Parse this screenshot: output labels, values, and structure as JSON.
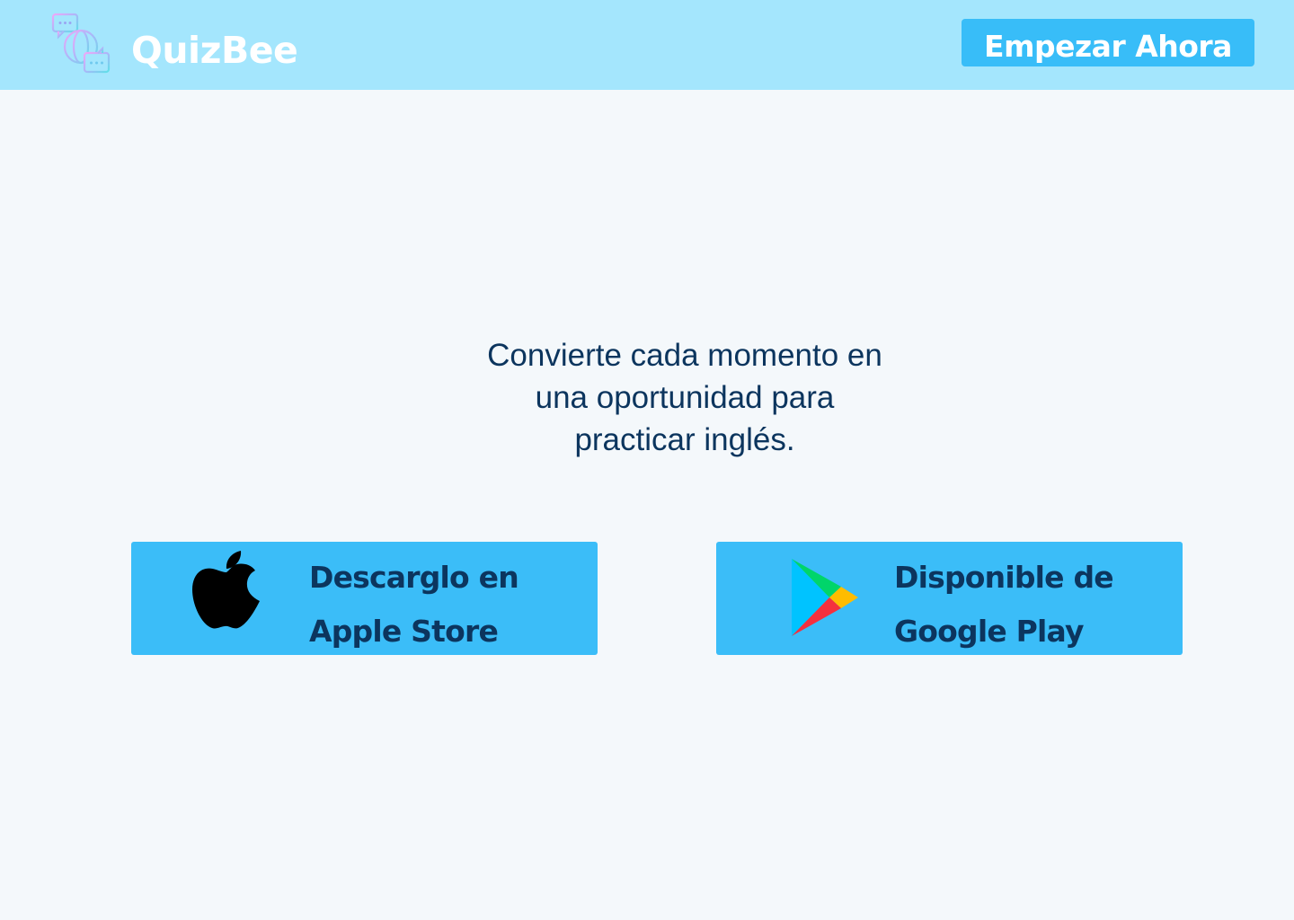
{
  "header": {
    "brand": "QuizBee",
    "logo_icon": "globe-chat-icon",
    "cta_label": "Empezar Ahora"
  },
  "hero": {
    "tagline_lines": [
      "Convierte cada momento en",
      "una oportunidad para",
      "practicar inglés."
    ]
  },
  "downloads": {
    "apple": {
      "icon": "apple-icon",
      "line1": "Descarglo en",
      "line2": "Apple Store"
    },
    "google": {
      "icon": "google-play-icon",
      "line1": "Disponible de",
      "line2": "Google Play"
    }
  },
  "colors": {
    "header_bg": "#a4e6fd",
    "page_bg": "#f4f8fb",
    "accent": "#38bdf8",
    "text_dark": "#0c355e"
  }
}
